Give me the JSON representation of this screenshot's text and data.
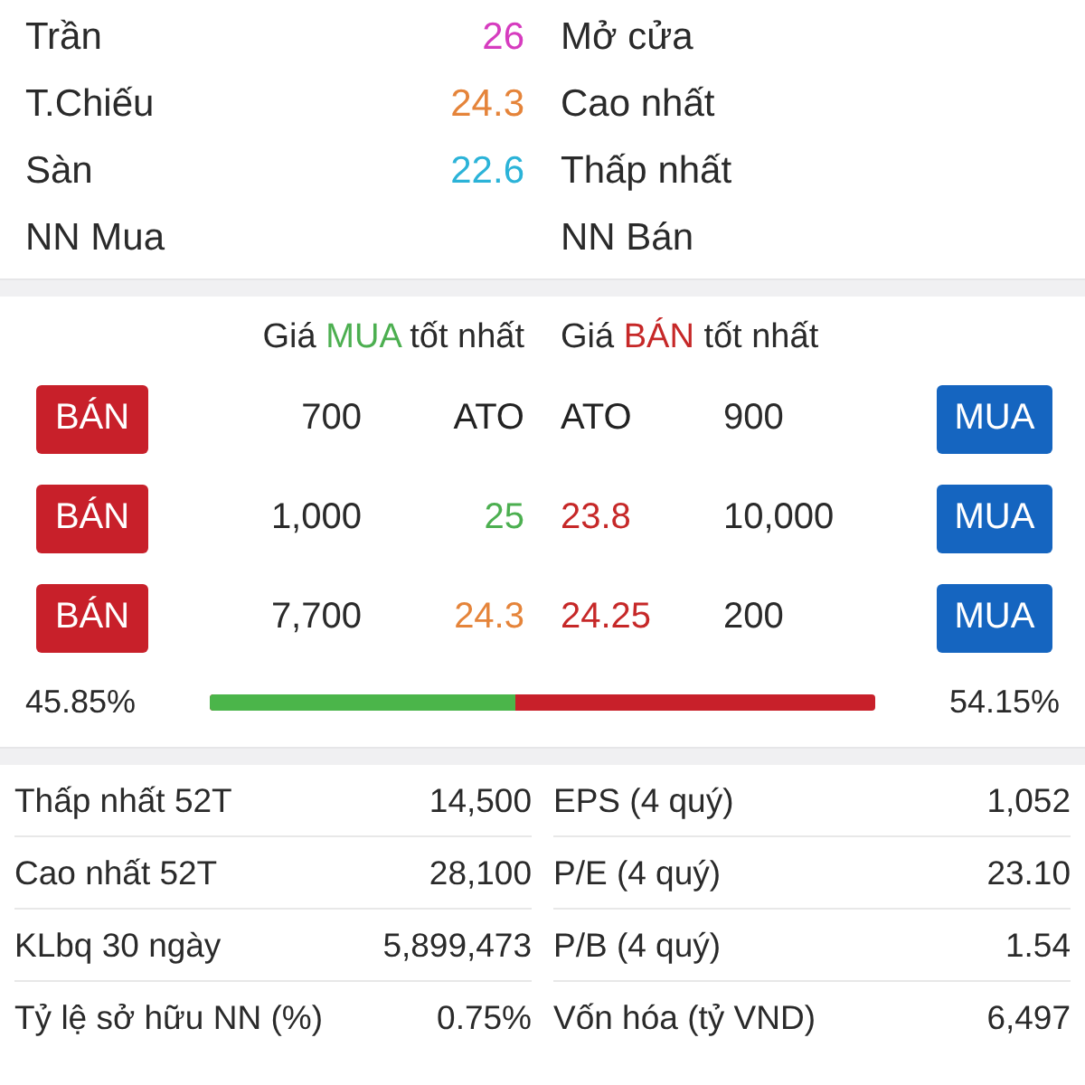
{
  "summary": [
    {
      "label": "Trần",
      "value": "26",
      "color": "#d63cbf",
      "right_label": "Mở cửa"
    },
    {
      "label": "T.Chiếu",
      "value": "24.3",
      "color": "#e5843a",
      "right_label": "Cao nhất"
    },
    {
      "label": "Sàn",
      "value": "22.6",
      "color": "#2bb3d8",
      "right_label": "Thấp nhất"
    },
    {
      "label": "NN Mua",
      "right_label": "NN Bán"
    }
  ],
  "order_book": {
    "bid_title": {
      "prefix": "Giá",
      "highlight": "MUA",
      "suffix": "tốt nhất",
      "color": "#4caf50"
    },
    "ask_title": {
      "prefix": "Giá",
      "highlight": "BÁN",
      "suffix": "tốt nhất",
      "color": "#c62828"
    },
    "rows": [
      {
        "sell_button": "BÁN",
        "bid": {
          "volume": "700",
          "price": "ATO",
          "color": "#222222"
        },
        "ask": {
          "price": "ATO",
          "color": "#222222",
          "volume": "900"
        },
        "buy_button": "MUA"
      },
      {
        "sell_button": "BÁN",
        "bid": {
          "volume": "1,000",
          "price": "25",
          "color": "#4caf50"
        },
        "ask": {
          "price": "23.8",
          "color": "#c62828",
          "volume": "10,000"
        },
        "buy_button": "MUA"
      },
      {
        "sell_button": "BÁN",
        "bid": {
          "volume": "7,700",
          "price": "24.3",
          "color": "#e5843a"
        },
        "ask": {
          "price": "24.25",
          "color": "#c62828",
          "volume": "200"
        },
        "buy_button": "MUA"
      }
    ],
    "ratio": {
      "buy_percent": "45.85%",
      "sell_percent": "54.15%",
      "level": 0.4585
    }
  },
  "stats": [
    {
      "left_label": "Thấp nhất 52T",
      "left_value": "14,500",
      "right_label": "EPS (4 quý)",
      "right_value": "1,052"
    },
    {
      "left_label": "Cao nhất 52T",
      "left_value": "28,100",
      "right_label": "P/E (4 quý)",
      "right_value": "23.10"
    },
    {
      "left_label": "KLbq 30 ngày",
      "left_value": "5,899,473",
      "right_label": "P/B (4 quý)",
      "right_value": "1.54"
    },
    {
      "left_label": "Tỷ lệ sở hữu NN (%)",
      "left_value": "0.75%",
      "right_label": "Vốn hóa (tỷ VND)",
      "right_value": "6,497"
    }
  ]
}
